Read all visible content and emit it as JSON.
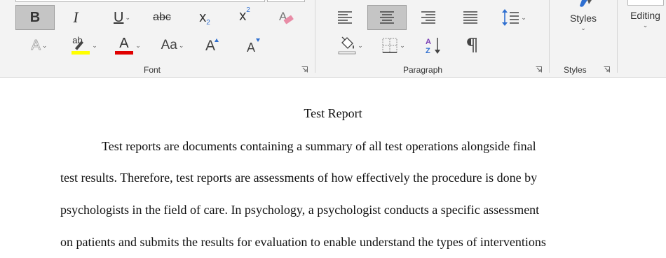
{
  "ribbon": {
    "groups": {
      "font": {
        "label": "Font"
      },
      "paragraph": {
        "label": "Paragraph"
      },
      "styles": {
        "label": "Styles",
        "button_label": "Styles"
      },
      "editing": {
        "label": "Editing"
      }
    },
    "font_buttons": {
      "bold": "B",
      "italic": "I",
      "underline": "U",
      "strikethrough": "abc",
      "subscript_base": "x",
      "subscript_sup": "2",
      "superscript_base": "x",
      "superscript_sup": "2",
      "text_effects": "A",
      "highlight": "ab",
      "font_color": "A",
      "change_case": "Aa",
      "grow_font": "A",
      "shrink_font": "A"
    },
    "colors": {
      "highlight": "#ffff00",
      "font_color": "#e00000",
      "selected_bg": "#c5c5c5"
    },
    "dropdown_glyph": "⌄"
  },
  "document": {
    "title": "Test Report",
    "paragraph_lines": [
      "Test reports are documents containing a summary of all test operations alongside final",
      "test results. Therefore, test reports are assessments of how effectively the procedure is done by",
      "psychologists in the field of care. In psychology, a psychologist conducts a specific assessment",
      "on patients and submits the results for evaluation to enable understand the types of interventions"
    ]
  }
}
